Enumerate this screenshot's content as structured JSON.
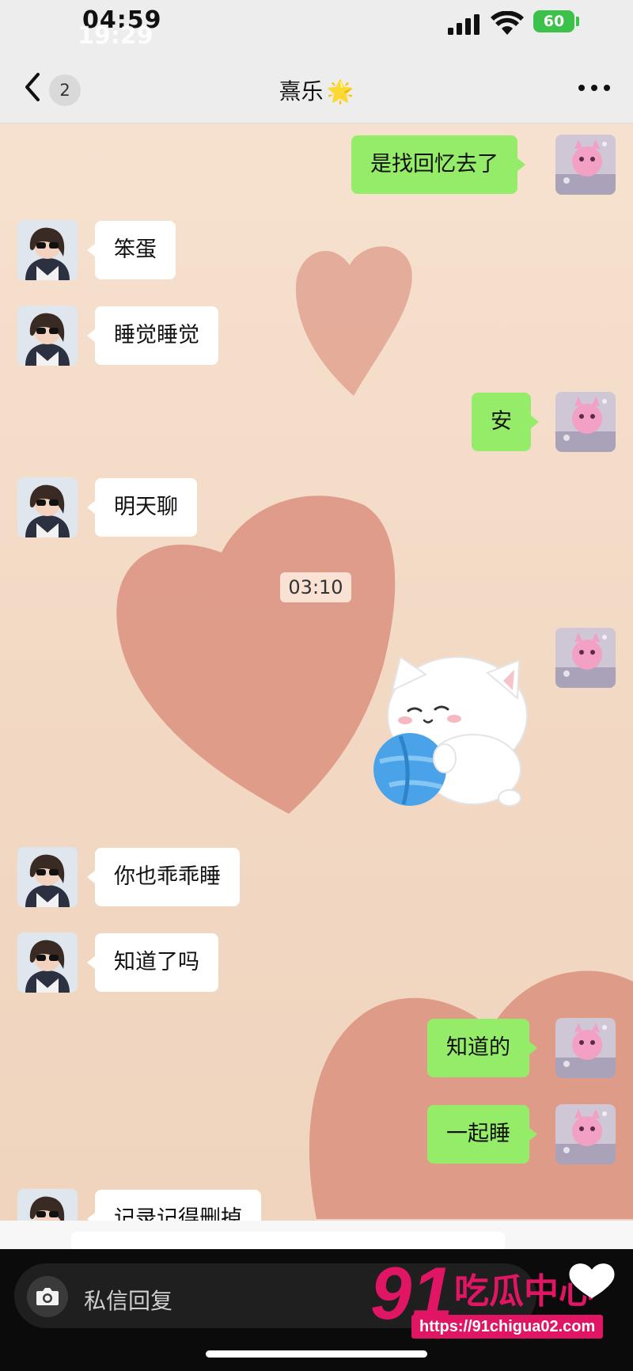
{
  "status_bar": {
    "time": "04:59",
    "time_overlay": "19:29",
    "battery": "60"
  },
  "nav": {
    "back_count": "2",
    "title": "熹乐",
    "title_emoji": "🌟"
  },
  "messages": [
    {
      "side": "right",
      "text": "是找回忆去了"
    },
    {
      "side": "left",
      "text": "笨蛋"
    },
    {
      "side": "left",
      "text": "睡觉睡觉"
    },
    {
      "side": "right",
      "text": "安"
    },
    {
      "side": "left",
      "text": "明天聊"
    },
    {
      "side": "right",
      "text": "[sticker]"
    },
    {
      "side": "left",
      "text": "你也乖乖睡"
    },
    {
      "side": "left",
      "text": "知道了吗"
    },
    {
      "side": "right",
      "text": "知道的"
    },
    {
      "side": "right",
      "text": "一起睡"
    },
    {
      "side": "left",
      "text": "记录记得删掉"
    }
  ],
  "timestamp": "03:10",
  "reply": {
    "placeholder": "私信回复"
  },
  "watermark": {
    "brand_number": "91",
    "brand_text": "吃瓜中心",
    "url": "https://91chigua02.com"
  },
  "colors": {
    "sent_bubble": "#95ec69",
    "received_bubble": "#ffffff",
    "chat_background": "#f3ddc9",
    "heart": "#d98a78",
    "watermark": "#e01563"
  },
  "icons": [
    "back-chevron-icon",
    "more-dots-icon",
    "camera-icon",
    "signal-icon",
    "wifi-icon",
    "battery-icon"
  ]
}
